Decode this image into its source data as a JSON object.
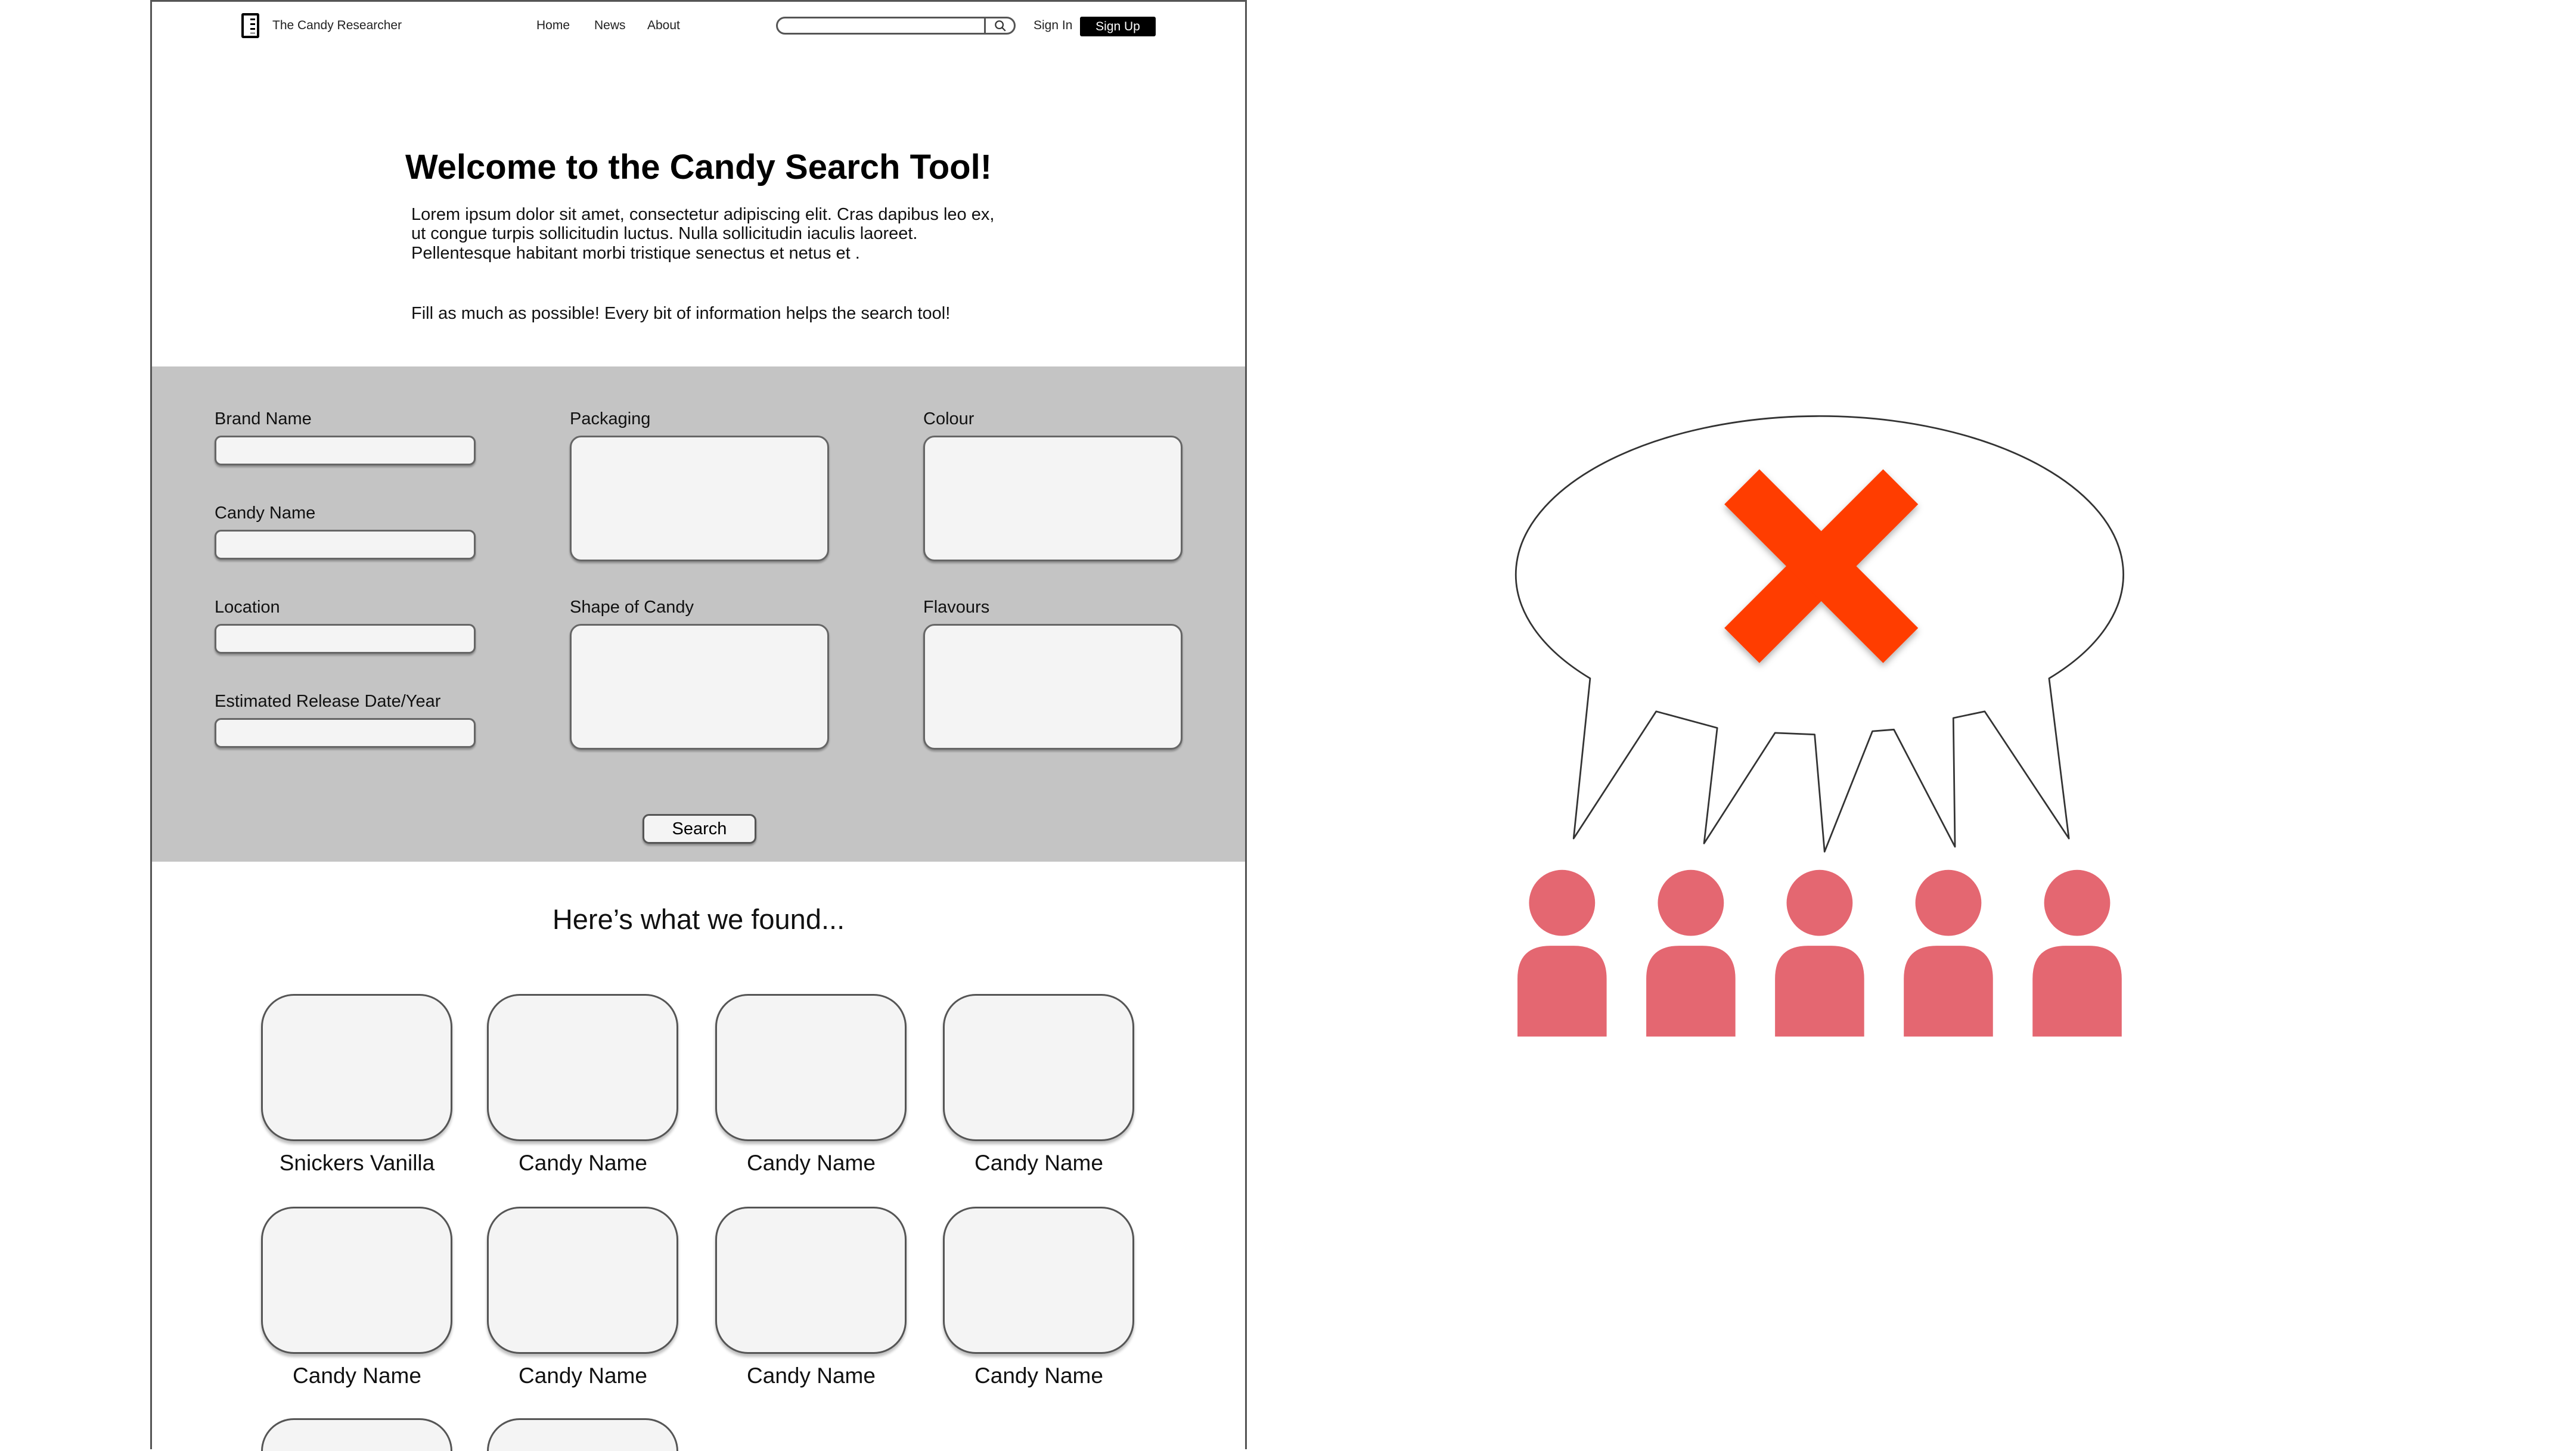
{
  "header": {
    "brand": "The Candy Researcher",
    "nav": [
      "Home",
      "News",
      "About"
    ],
    "search_placeholder": "",
    "sign_in": "Sign In",
    "sign_up": "Sign Up"
  },
  "intro": {
    "title": "Welcome to the Candy Search Tool!",
    "body": "Lorem ipsum dolor sit amet, consectetur adipiscing elit. Cras dapibus leo ex, ut congue turpis sollicitudin luctus. Nulla sollicitudin iaculis laoreet. Pellentesque habitant morbi tristique senectus et netus et .",
    "hint": "Fill as much as possible! Every bit of information helps the search tool!"
  },
  "form": {
    "fields": {
      "brand": "Brand Name",
      "candy": "Candy Name",
      "location": "Location",
      "release": "Estimated Release Date/Year",
      "packaging": "Packaging",
      "colour": "Colour",
      "shape": "Shape of Candy",
      "flavours": "Flavours"
    },
    "values": {
      "brand": "",
      "candy": "",
      "location": "",
      "release": "",
      "packaging": "",
      "colour": "",
      "shape": "",
      "flavours": ""
    },
    "search_button": "Search"
  },
  "results": {
    "heading": "Here’s what we found...",
    "items": [
      "Snickers Vanilla",
      "Candy Name",
      "Candy Name",
      "Candy Name",
      "Candy Name",
      "Candy Name",
      "Candy Name",
      "Candy Name",
      "",
      ""
    ]
  },
  "illustration": {
    "colors": {
      "x_mark": "#ff3c00",
      "people": "#e46771",
      "bubble_stroke": "#333333"
    },
    "icons": [
      "speech-bubble",
      "x-mark-icon",
      "person-icon"
    ]
  }
}
